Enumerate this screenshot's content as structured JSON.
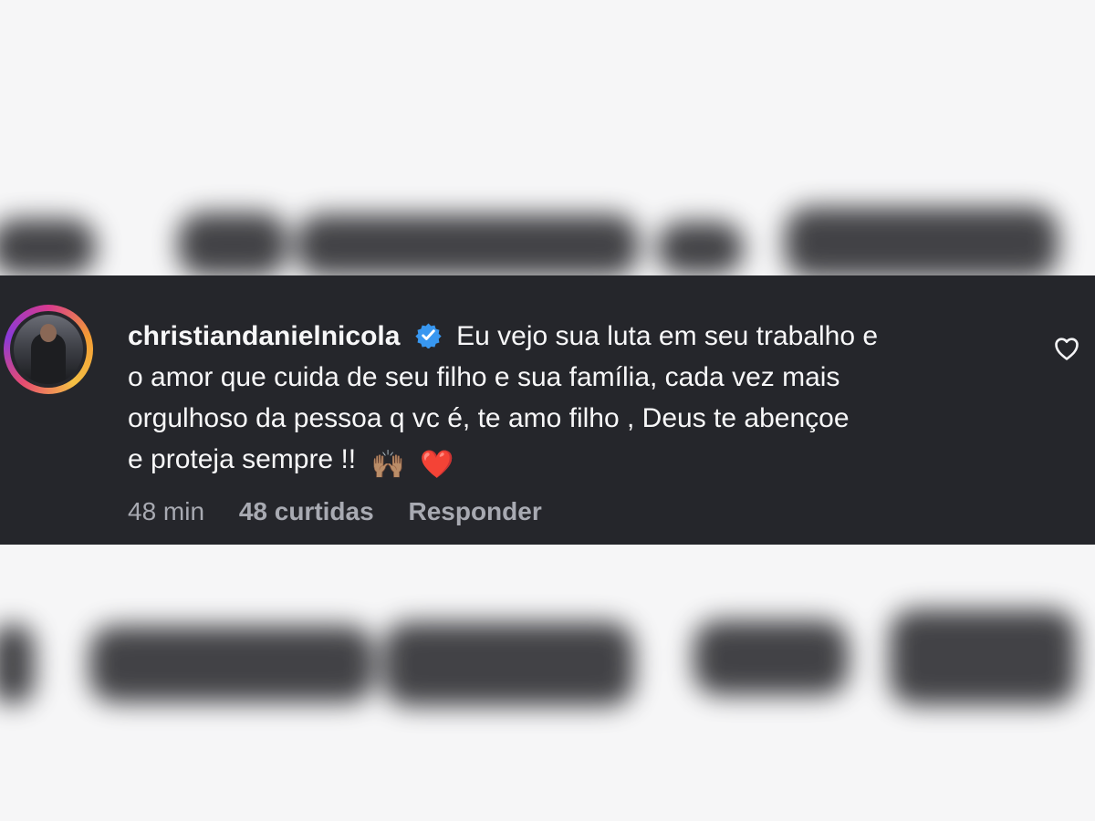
{
  "comment": {
    "username": "christiandanielnicola",
    "lines": [
      "Eu vejo sua luta em seu trabalho e",
      "o amor que cuida de seu filho e sua família, cada vez mais",
      "orgulhoso da pessoa q vc é, te amo filho , Deus te abençoe",
      "e proteja sempre !!"
    ],
    "emoji_1": "🙌🏽",
    "emoji_2": "❤️"
  },
  "meta": {
    "time": "48 min",
    "likes": "48 curtidas",
    "reply": "Responder"
  },
  "colors": {
    "panel_background": "#25262b",
    "verified_blue": "#3897f0",
    "meta_text": "#a8aab2"
  },
  "icons": {
    "verified": "verified-badge-icon",
    "like": "heart-outline-icon"
  }
}
